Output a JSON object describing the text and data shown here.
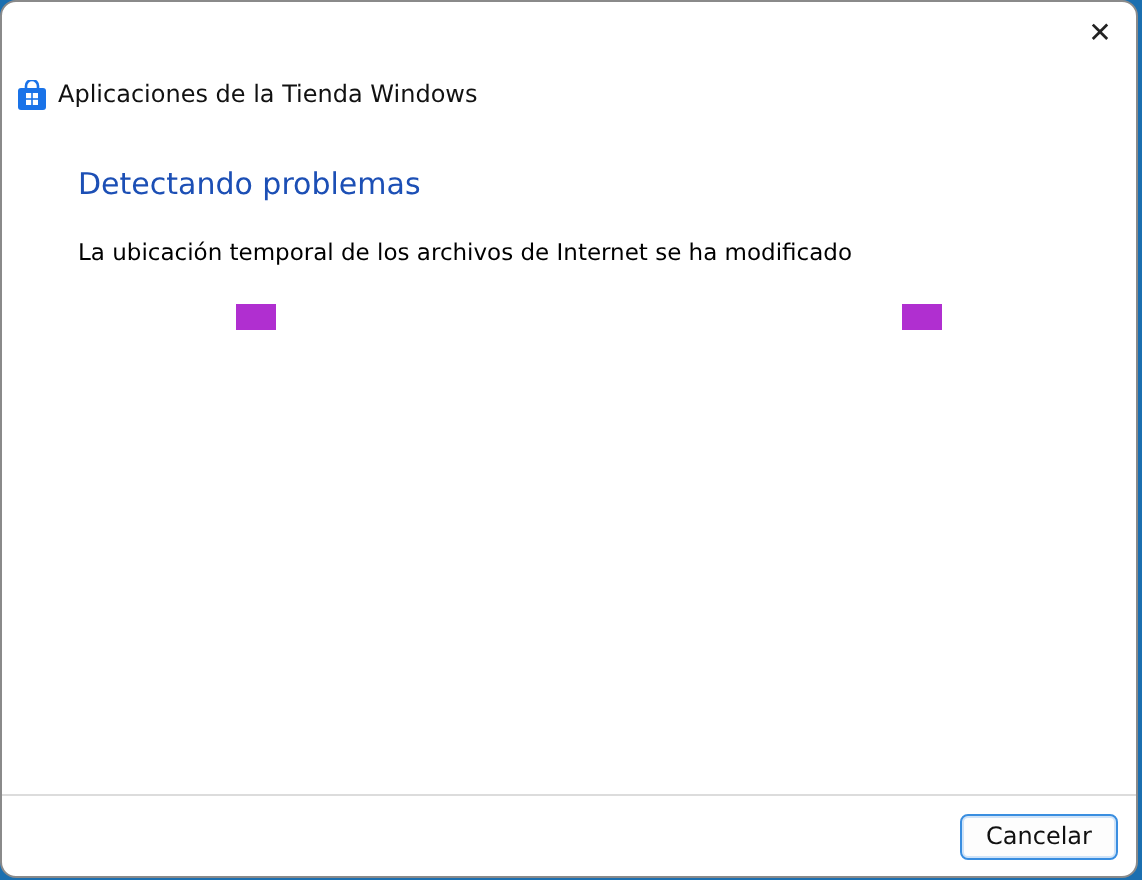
{
  "window": {
    "title": "Aplicaciones de la Tienda Windows",
    "close": "✕"
  },
  "heading": "Detectando problemas",
  "message": "La ubicación temporal de los archivos de Internet se ha modificado",
  "buttons": [
    {
      "label": "Cancelar",
      "kind": "default"
    }
  ]
}
